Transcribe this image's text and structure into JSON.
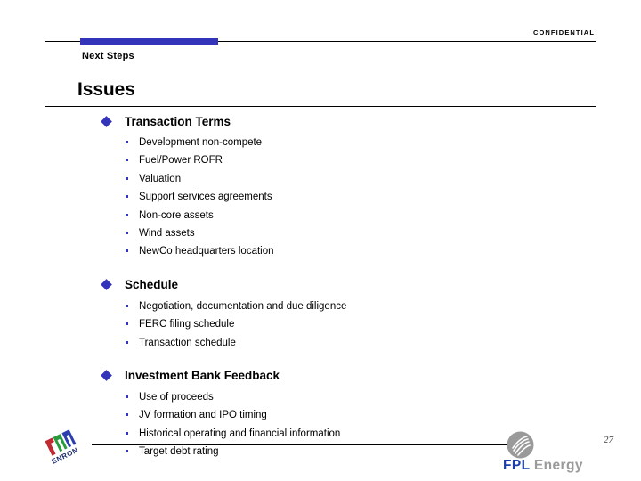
{
  "header": {
    "confidential": "CONFIDENTIAL",
    "kicker": "Next Steps",
    "accent_color": "#3434bb"
  },
  "title": "Issues",
  "groups": [
    {
      "label": "Transaction Terms",
      "bullet_icon": "diamond-bullet-icon",
      "items": [
        "Development non-compete",
        "Fuel/Power ROFR",
        "Valuation",
        "Support services agreements",
        "Non-core assets",
        "Wind assets",
        "NewCo headquarters location"
      ]
    },
    {
      "label": "Schedule",
      "bullet_icon": "diamond-bullet-icon",
      "items": [
        "Negotiation, documentation and due diligence",
        "FERC filing schedule",
        "Transaction schedule"
      ]
    },
    {
      "label": "Investment Bank Feedback",
      "bullet_icon": "diamond-bullet-icon",
      "items": [
        "Use of proceeds",
        "JV formation and IPO timing",
        "Historical operating and financial information",
        "Target debt rating"
      ]
    }
  ],
  "footer": {
    "page_number": "27",
    "enron_logo_text": "ENRON",
    "fpl_logo_primary": "FPL",
    "fpl_logo_secondary": "Energy"
  }
}
